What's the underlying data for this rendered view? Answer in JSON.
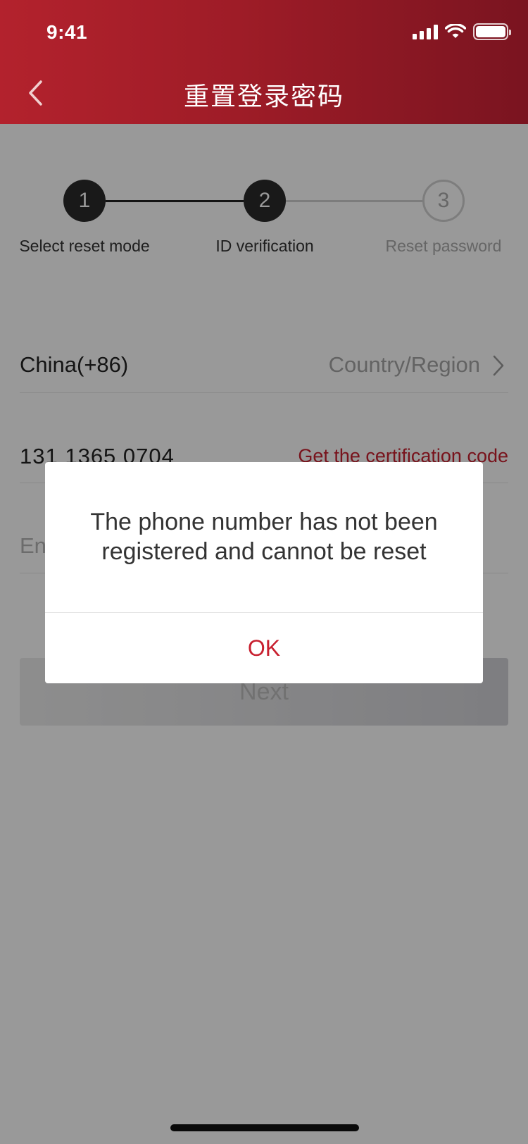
{
  "status_bar": {
    "time": "9:41"
  },
  "header": {
    "title": "重置登录密码"
  },
  "stepper": {
    "steps": [
      {
        "number": "1",
        "label": "Select reset mode",
        "state": "completed"
      },
      {
        "number": "2",
        "label": "ID verification",
        "state": "active"
      },
      {
        "number": "3",
        "label": "Reset password",
        "state": "pending"
      }
    ]
  },
  "form": {
    "country": {
      "value": "China(+86)",
      "label": "Country/Region"
    },
    "phone": {
      "value": "131 1365 0704",
      "get_code_label": "Get the certification code"
    },
    "code": {
      "placeholder": "En"
    },
    "next_label": "Next"
  },
  "dialog": {
    "message": "The phone number has not been registered and cannot be reset",
    "ok_label": "OK"
  },
  "colors": {
    "brand_red": "#b3222d",
    "accent_red": "#c8202f",
    "active_step": "#2b2b2b"
  }
}
